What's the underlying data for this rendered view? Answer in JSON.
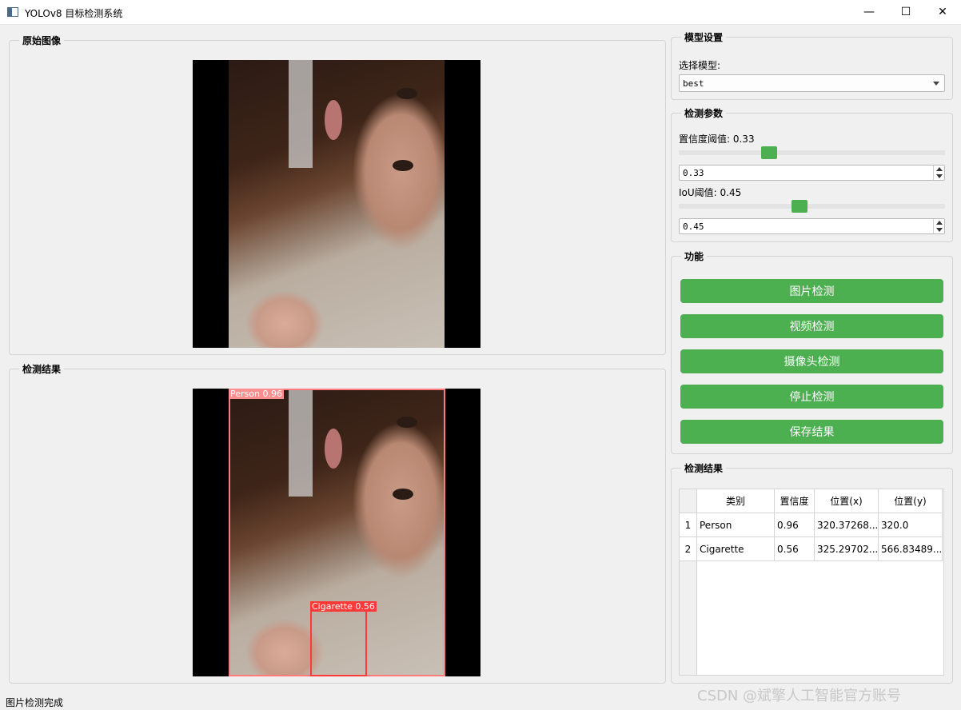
{
  "window": {
    "title": "YOLOv8 目标检测系统",
    "min": "—",
    "max": "☐",
    "close": "✕"
  },
  "original_image": {
    "title": "原始图像"
  },
  "result_image": {
    "title": "检测结果",
    "detections": [
      {
        "label": "Person 0.96"
      },
      {
        "label": "Cigarette 0.56"
      }
    ]
  },
  "model_settings": {
    "title": "模型设置",
    "select_label": "选择模型:",
    "selected": "best"
  },
  "detect_params": {
    "title": "检测参数",
    "conf_label": "置信度阈值: 0.33",
    "conf_value": "0.33",
    "conf_level": 0.33,
    "iou_label": "IoU阈值: 0.45",
    "iou_value": "0.45",
    "iou_level": 0.45
  },
  "functions": {
    "title": "功能",
    "image_detect": "图片检测",
    "video_detect": "视频检测",
    "camera_detect": "摄像头检测",
    "stop_detect": "停止检测",
    "save_results": "保存结果"
  },
  "results_table": {
    "title": "检测结果",
    "headers": [
      "类别",
      "置信度",
      "位置(x)",
      "位置(y)"
    ],
    "rows": [
      {
        "index": "1",
        "cells": [
          "Person",
          "0.96",
          "320.37268...",
          "320.0"
        ]
      },
      {
        "index": "2",
        "cells": [
          "Cigarette",
          "0.56",
          "325.29702...",
          "566.83489..."
        ]
      }
    ]
  },
  "status": {
    "text": "图片检测完成"
  },
  "watermark": "CSDN @斌擎人工智能官方账号",
  "colors": {
    "accent": "#4caf50",
    "person_box": "#ff7a7a",
    "cigarette_box": "#ff3838"
  }
}
